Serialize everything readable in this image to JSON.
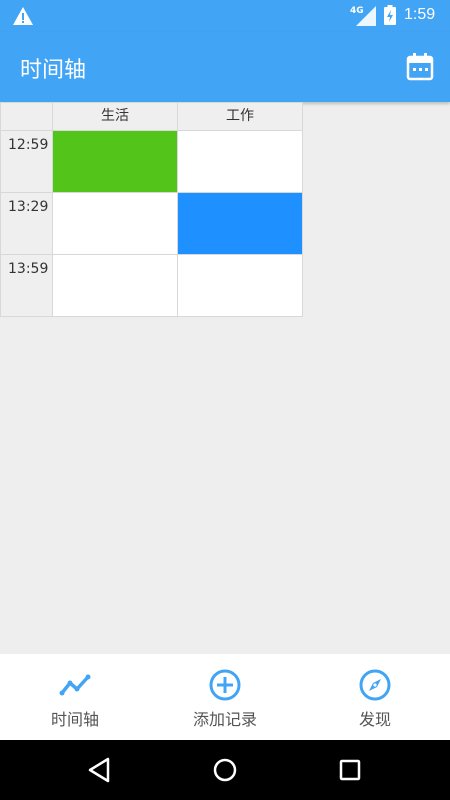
{
  "status_bar": {
    "time": "1:59",
    "network": "4G"
  },
  "app_bar": {
    "title": "时间轴"
  },
  "timeline": {
    "columns": [
      "生活",
      "工作"
    ],
    "rows": [
      {
        "time": "12:59",
        "cells": [
          {
            "color": "#52c41a"
          },
          {
            "color": "#ffffff"
          }
        ]
      },
      {
        "time": "13:29",
        "cells": [
          {
            "color": "#ffffff"
          },
          {
            "color": "#1e90ff"
          }
        ]
      },
      {
        "time": "13:59",
        "cells": [
          {
            "color": "#ffffff"
          },
          {
            "color": "#ffffff"
          }
        ]
      }
    ]
  },
  "bottom_nav": {
    "accent": "#42a4f5",
    "tabs": [
      {
        "label": "时间轴",
        "icon": "timeline-chart-icon"
      },
      {
        "label": "添加记录",
        "icon": "add-circle-icon"
      },
      {
        "label": "发现",
        "icon": "compass-icon"
      }
    ]
  },
  "system_nav": {
    "icons": [
      "back-icon",
      "home-icon",
      "recents-icon"
    ]
  }
}
